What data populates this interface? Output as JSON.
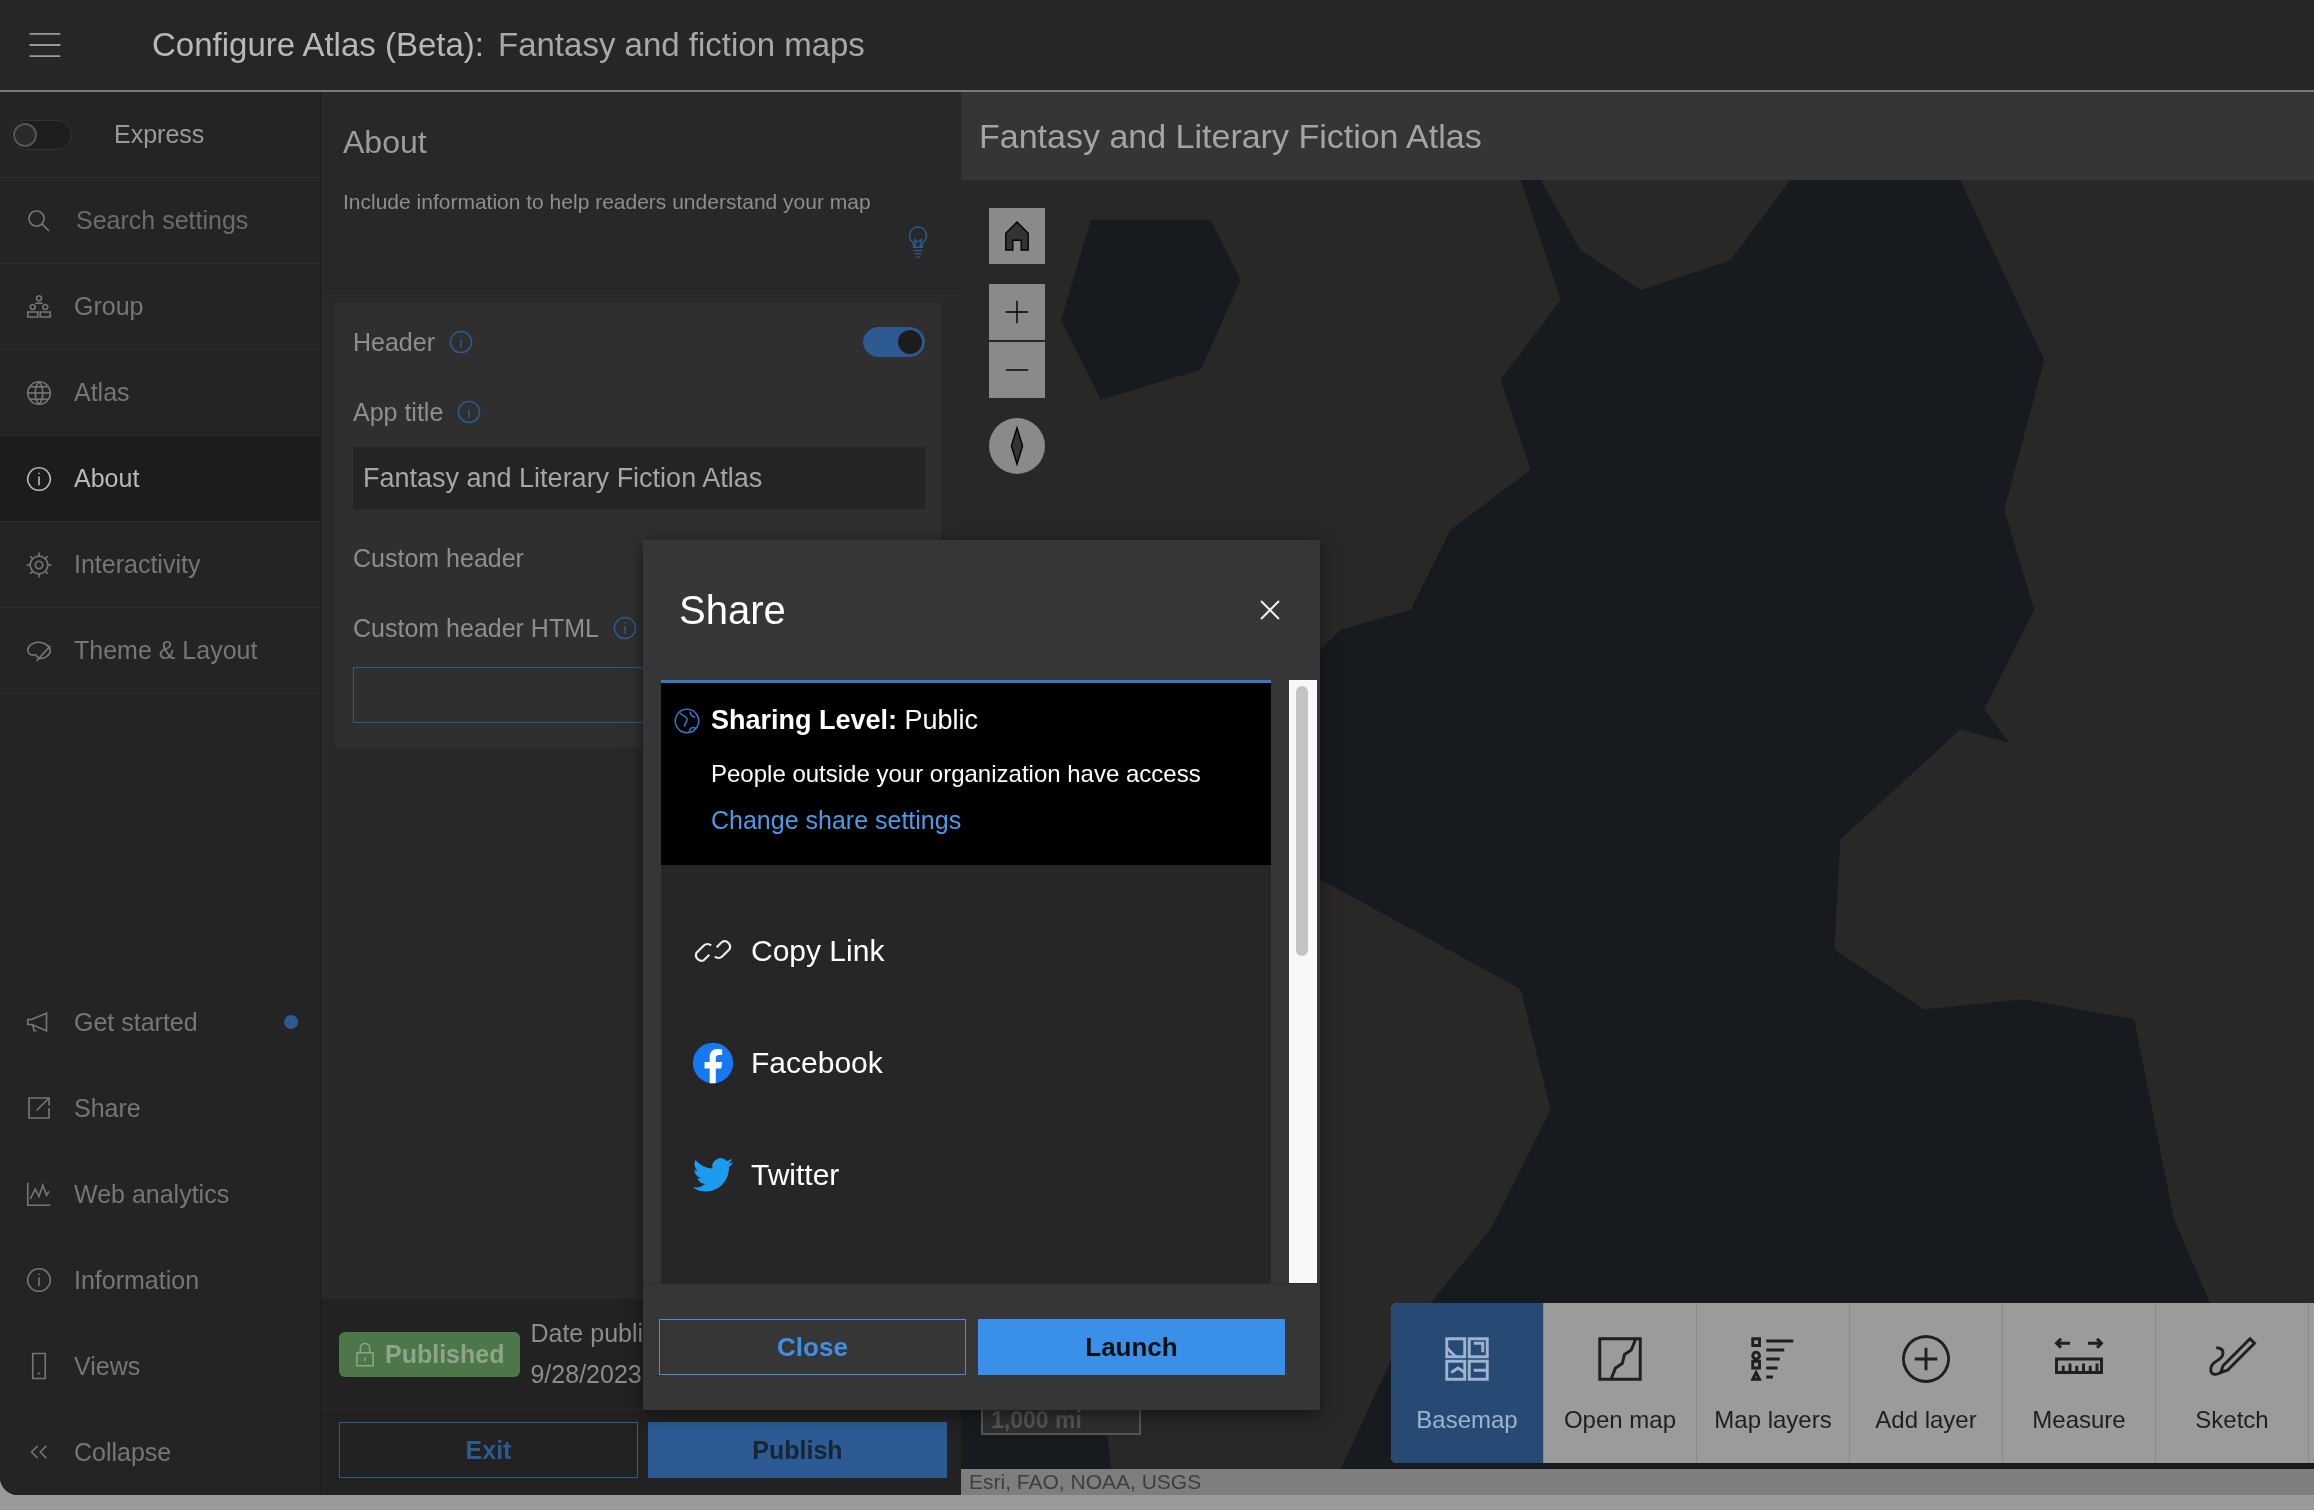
{
  "app_bar": {
    "title": "Configure Atlas (Beta):",
    "subtitle": "Fantasy and fiction maps"
  },
  "sidebar": {
    "express": {
      "label": "Express",
      "on": false
    },
    "search": {
      "placeholder": "Search settings"
    },
    "items": [
      {
        "label": "Group",
        "selected": false
      },
      {
        "label": "Atlas",
        "selected": false
      },
      {
        "label": "About",
        "selected": true
      },
      {
        "label": "Interactivity",
        "selected": false
      },
      {
        "label": "Theme & Layout",
        "selected": false
      }
    ],
    "footer_items": [
      {
        "label": "Get started",
        "notification": true
      },
      {
        "label": "Share",
        "notification": false
      },
      {
        "label": "Web analytics",
        "notification": false
      },
      {
        "label": "Information",
        "notification": false
      },
      {
        "label": "Views",
        "notification": false
      },
      {
        "label": "Collapse",
        "notification": false
      }
    ]
  },
  "settings": {
    "title": "About",
    "description": "Include information to help readers understand your map",
    "fields": [
      {
        "kind": "toggle",
        "label": "Header",
        "info": true,
        "on": true
      },
      {
        "kind": "text",
        "label": "App title",
        "info": true,
        "value": "Fantasy and Literary Fiction Atlas"
      },
      {
        "kind": "label",
        "label": "Custom header",
        "info": false
      },
      {
        "kind": "html",
        "label": "Custom header HTML",
        "info": true
      }
    ]
  },
  "status": {
    "badge": "Published",
    "date_label": "Date publi",
    "date": "9/28/2023"
  },
  "actions": [
    {
      "label": "Exit",
      "kind": "secondary"
    },
    {
      "label": "Publish",
      "kind": "primary"
    }
  ],
  "map": {
    "title": "Fantasy and Literary Fiction Atlas",
    "scale": "1,000 mi",
    "attribution": "Esri, FAO, NOAA, USGS",
    "tools": [
      {
        "label": "Basemap",
        "selected": true
      },
      {
        "label": "Open map",
        "selected": false
      },
      {
        "label": "Map layers",
        "selected": false
      },
      {
        "label": "Add layer",
        "selected": false
      },
      {
        "label": "Measure",
        "selected": false
      },
      {
        "label": "Sketch",
        "selected": false
      }
    ]
  },
  "modal": {
    "title": "Share",
    "sharing": {
      "heading": "**Sharing Level:** Public",
      "description": "People outside your organization have access",
      "link": "Change share settings"
    },
    "options": [
      {
        "label": "Copy Link"
      },
      {
        "label": "Facebook"
      },
      {
        "label": "Twitter"
      }
    ],
    "buttons": [
      {
        "label": "Close",
        "kind": "secondary"
      },
      {
        "label": "Launch",
        "kind": "primary"
      }
    ]
  }
}
